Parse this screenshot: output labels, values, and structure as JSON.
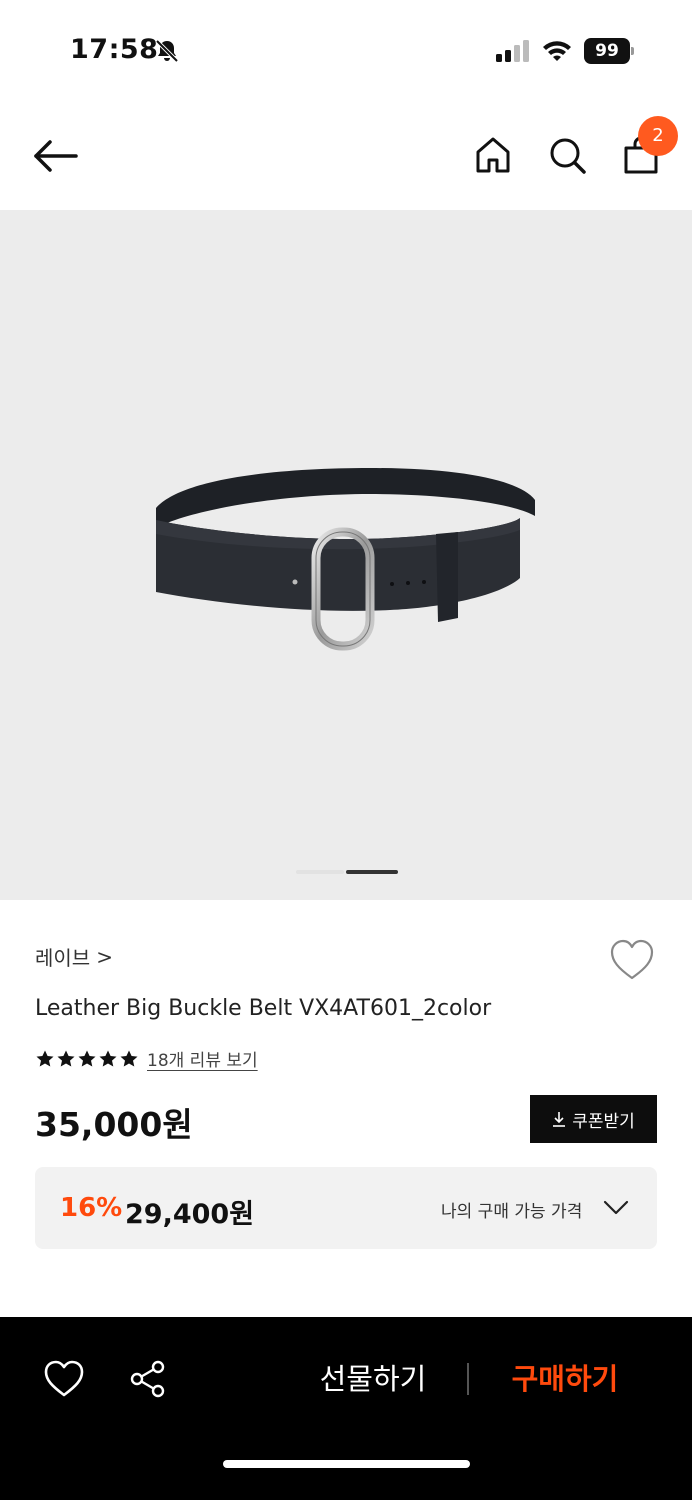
{
  "status_bar": {
    "time": "17:58",
    "battery": "99"
  },
  "nav": {
    "cart_count": "2"
  },
  "gallery": {
    "image_alt": "Leather Big Buckle Belt",
    "total_slides": 2,
    "active_slide": 2
  },
  "product": {
    "brand": "레이브",
    "brand_chevron": ">",
    "name": "Leather Big Buckle Belt VX4AT601_2color",
    "rating_stars": 5,
    "review_link": "18개 리뷰 보기",
    "price": "35,000원",
    "coupon_label": "쿠폰받기"
  },
  "discount": {
    "rate": "16%",
    "price": "29,400원",
    "my_price_label": "나의 구매 가능 가격"
  },
  "bottom_bar": {
    "gift_label": "선물하기",
    "buy_label": "구매하기"
  },
  "colors": {
    "accent": "#ff4a0d",
    "badge": "#ff5a1f",
    "image_bg": "#ececec"
  },
  "icons": [
    "bell-slash-icon",
    "signal-icon",
    "wifi-icon",
    "back-arrow-icon",
    "home-icon",
    "search-icon",
    "shopping-bag-icon",
    "heart-icon",
    "star-icon",
    "download-icon",
    "chevron-down-icon",
    "share-icon"
  ]
}
